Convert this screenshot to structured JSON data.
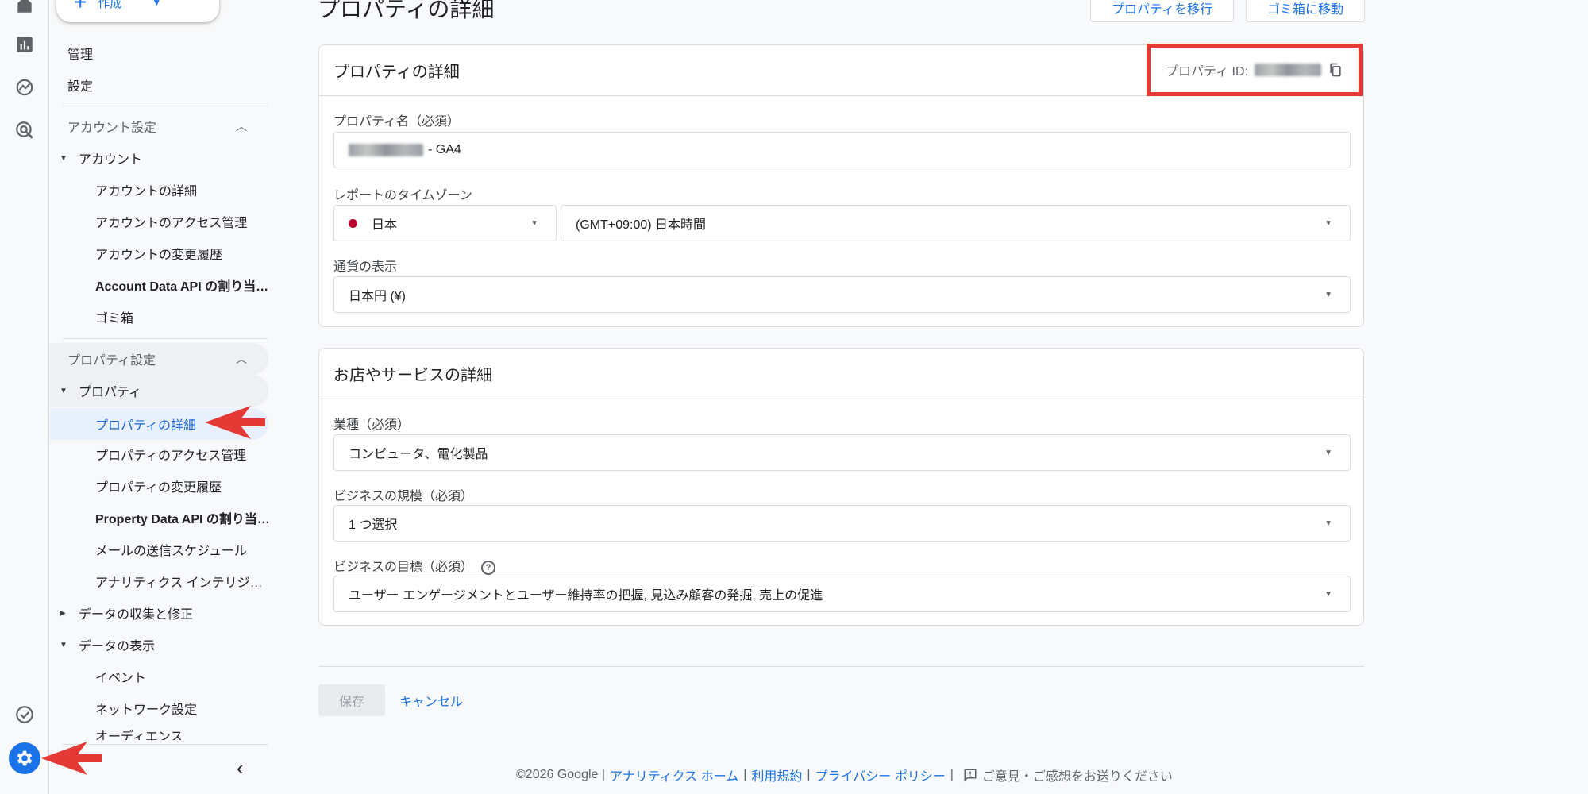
{
  "colors": {
    "accent": "#1a73e8",
    "highlight_red": "#e53935"
  },
  "header": {
    "title": "プロパティの詳細",
    "migrate_label": "プロパティを移行",
    "trash_label": "ゴミ箱に移動",
    "create_label": "作成"
  },
  "sidebar": {
    "manage": "管理",
    "settings": "設定",
    "account_section": "アカウント設定",
    "account_parent": "アカウント",
    "account_items": [
      "アカウントの詳細",
      "アカウントのアクセス管理",
      "アカウントの変更履歴",
      "Account Data API の割り当…",
      "ゴミ箱"
    ],
    "property_section": "プロパティ設定",
    "property_parent": "プロパティ",
    "property_items": [
      "プロパティの詳細",
      "プロパティのアクセス管理",
      "プロパティの変更履歴",
      "Property Data API の割り当…",
      "メールの送信スケジュール",
      "アナリティクス インテリジ…"
    ],
    "data_collection": "データの収集と修正",
    "data_display": "データの表示",
    "data_display_items": [
      "イベント",
      "ネットワーク設定",
      "オーディエンス"
    ]
  },
  "property_card": {
    "title": "プロパティの詳細",
    "id_label": "プロパティ ID:",
    "name_label": "プロパティ名（必須）",
    "name_suffix": "- GA4",
    "timezone_label": "レポートのタイムゾーン",
    "country": "日本",
    "timezone": "(GMT+09:00) 日本時間",
    "currency_label": "通貨の表示",
    "currency": "日本円 (¥)"
  },
  "business_card": {
    "title": "お店やサービスの詳細",
    "industry_label": "業種（必須）",
    "industry": "コンピュータ、電化製品",
    "size_label": "ビジネスの規模（必須）",
    "size": "1 つ選択",
    "goal_label": "ビジネスの目標（必須）",
    "goal": "ユーザー エンゲージメントとユーザー維持率の把握, 見込み顧客の発掘, 売上の促進"
  },
  "actions": {
    "save": "保存",
    "cancel": "キャンセル"
  },
  "footer": {
    "copyright": "©2026 Google |",
    "home": "アナリティクス ホーム",
    "terms": "利用規約",
    "privacy": "プライバシー ポリシー",
    "feedback": "ご意見・ご感想をお送りください"
  }
}
